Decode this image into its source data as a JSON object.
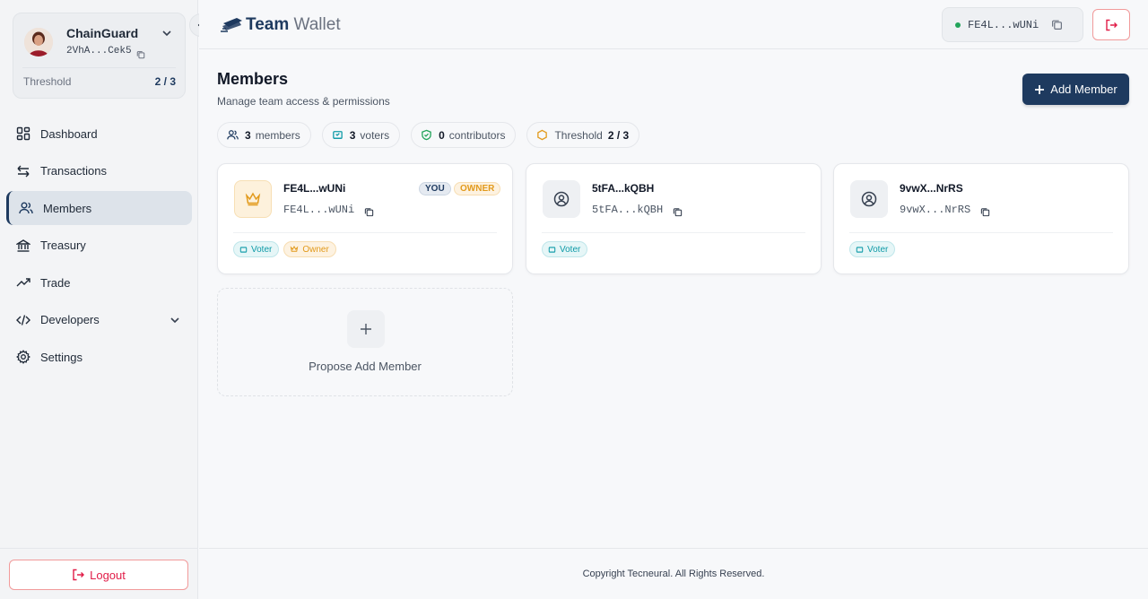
{
  "wallet": {
    "name": "ChainGuard",
    "address": "2VhA...Cek5",
    "threshold_label": "Threshold",
    "threshold_value": "2 / 3"
  },
  "nav": {
    "items": [
      {
        "label": "Dashboard",
        "icon": "grid-icon"
      },
      {
        "label": "Transactions",
        "icon": "arrows-icon"
      },
      {
        "label": "Members",
        "icon": "users-icon"
      },
      {
        "label": "Treasury",
        "icon": "bank-icon"
      },
      {
        "label": "Trade",
        "icon": "trend-icon"
      },
      {
        "label": "Developers",
        "icon": "code-icon"
      },
      {
        "label": "Settings",
        "icon": "gear-icon"
      }
    ],
    "active": "Members"
  },
  "logout_label": "Logout",
  "brand": {
    "bold": "Team",
    "light": "Wallet"
  },
  "account": {
    "address": "FE4L...wUNi",
    "status_color": "#22a35a"
  },
  "page": {
    "title": "Members",
    "subtitle": "Manage team access & permissions",
    "add_button": "Add Member"
  },
  "stats": {
    "members_count": "3",
    "members_label": "members",
    "voters_count": "3",
    "voters_label": "voters",
    "contributors_count": "0",
    "contributors_label": "contributors",
    "threshold_label": "Threshold",
    "threshold_value": "2 / 3"
  },
  "members": [
    {
      "name": "FE4L...wUNi",
      "address": "FE4L...wUNi",
      "tag_you": "YOU",
      "tag_owner": "OWNER",
      "badges": [
        "Voter",
        "Owner"
      ]
    },
    {
      "name": "5tFA...kQBH",
      "address": "5tFA...kQBH",
      "badges": [
        "Voter"
      ]
    },
    {
      "name": "9vwX...NrRS",
      "address": "9vwX...NrRS",
      "badges": [
        "Voter"
      ]
    }
  ],
  "propose_label": "Propose Add Member",
  "footer": "Copyright Tecneural. All Rights Reserved.",
  "colors": {
    "primary": "#1e3a5f",
    "danger": "#e11d48",
    "voter": "#0e9aa7",
    "owner": "#e29a1c"
  }
}
